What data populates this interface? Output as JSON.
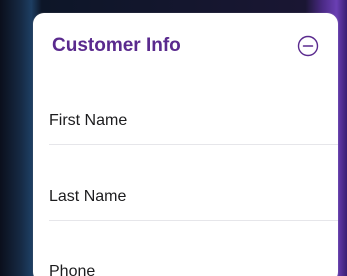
{
  "card": {
    "title": "Customer Info",
    "collapse_icon": "minus-circle-icon",
    "accent_color": "#5a2a8e"
  },
  "fields": {
    "first_name": {
      "label": "First Name",
      "value": ""
    },
    "last_name": {
      "label": "Last Name",
      "value": ""
    },
    "phone": {
      "label": "Phone",
      "value": ""
    }
  }
}
